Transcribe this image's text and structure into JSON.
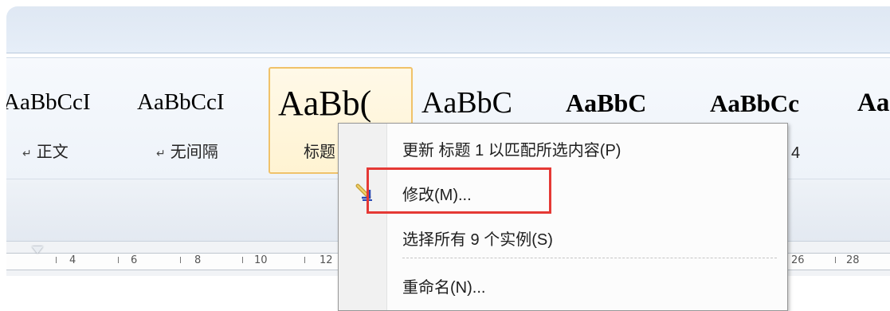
{
  "style_gallery": {
    "items": [
      {
        "sample": "AaBbCcI",
        "label": "正文",
        "has_para_mark": true
      },
      {
        "sample": "AaBbCcI",
        "label": "无间隔",
        "has_para_mark": true
      },
      {
        "sample": "AaBb(",
        "label": "标题",
        "selected": true
      },
      {
        "sample": "AaBbC",
        "label": ""
      },
      {
        "sample": "AaBbC",
        "label": ""
      },
      {
        "sample": "AaBbCc",
        "label": "4"
      },
      {
        "sample": "Aa",
        "label": ""
      }
    ]
  },
  "context_menu": {
    "items": [
      {
        "label": "更新 标题 1 以匹配所选内容(P)",
        "icon": null
      },
      {
        "label": "修改(M)...",
        "icon": "pencil-icon",
        "highlighted": true
      },
      {
        "label": "选择所有 9 个实例(S)",
        "icon": null
      },
      {
        "label": "重命名(N)...",
        "icon": null
      }
    ]
  },
  "ruler": {
    "labels": [
      "4",
      "6",
      "8",
      "10",
      "12",
      "26",
      "28"
    ]
  },
  "colors": {
    "accent_highlight": "#e53935",
    "selected_style_border": "#f0c26a"
  }
}
